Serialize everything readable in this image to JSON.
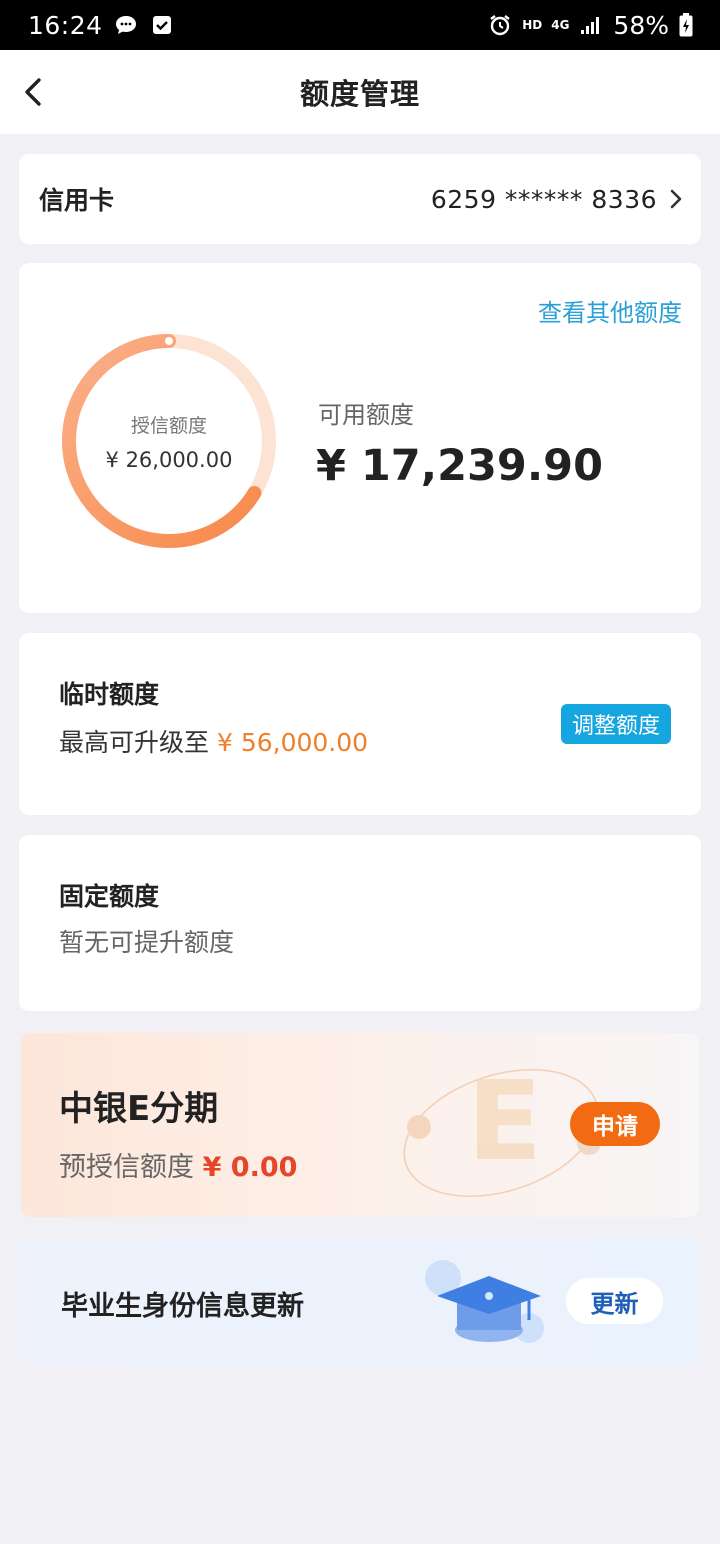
{
  "status_bar": {
    "time": "16:24",
    "hd_label": "HD",
    "network_label": "4G",
    "battery": "58%"
  },
  "nav": {
    "title": "额度管理"
  },
  "card_selector": {
    "label": "信用卡",
    "number": "6259 ****** 8336"
  },
  "limit": {
    "other_link": "查看其他额度",
    "credit_label": "授信额度",
    "credit_value": "¥ 26,000.00",
    "available_label": "可用额度",
    "available_value": "¥ 17,239.90",
    "available_fraction": 0.663
  },
  "temporary": {
    "title": "临时额度",
    "prefix": "最高可升级至",
    "amount": "¥ 56,000.00",
    "button": "调整额度"
  },
  "fixed": {
    "title": "固定额度",
    "subtitle": "暂无可提升额度"
  },
  "epay": {
    "title": "中银E分期",
    "sub_label": "预授信额度",
    "amount": "¥ 0.00",
    "button": "申请"
  },
  "graduate": {
    "title": "毕业生身份信息更新",
    "button": "更新"
  },
  "colors": {
    "accent_blue": "#16a6df",
    "ring_orange": "#f7894a",
    "apply_orange": "#f26a12",
    "update_blue": "#1f5fb8"
  }
}
